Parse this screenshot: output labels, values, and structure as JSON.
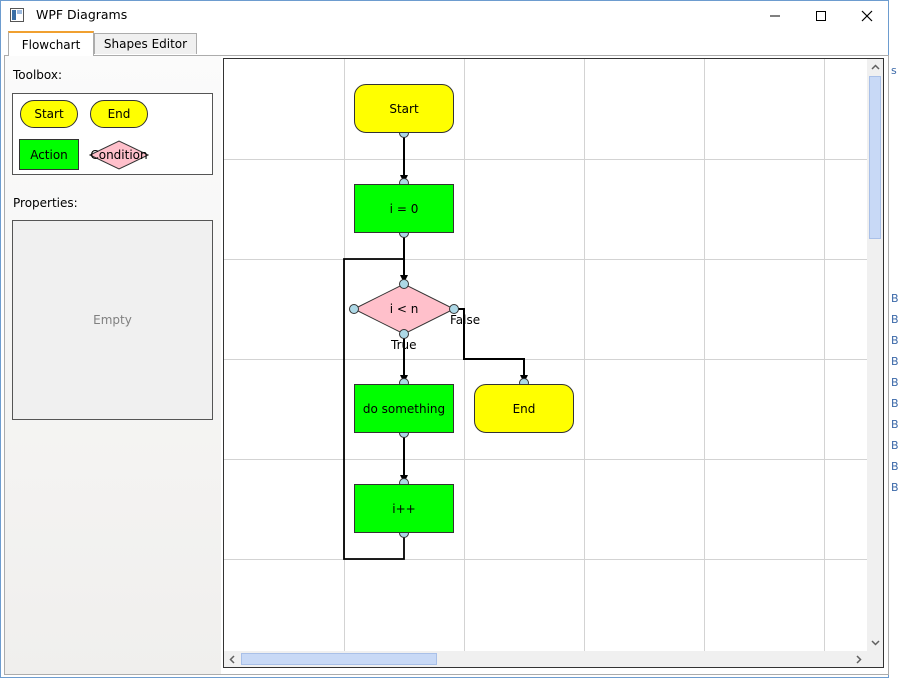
{
  "window": {
    "title": "WPF Diagrams"
  },
  "tabs": [
    {
      "label": "Flowchart"
    },
    {
      "label": "Shapes Editor"
    }
  ],
  "sidebar": {
    "toolbox_label": "Toolbox:",
    "toolbox_items": {
      "start": "Start",
      "end": "End",
      "action": "Action",
      "condition": "Condition"
    },
    "properties_label": "Properties:",
    "properties_empty": "Empty"
  },
  "diagram": {
    "start": "Start",
    "init": "i = 0",
    "condition": "i < n",
    "true_label": "True",
    "false_label": "False",
    "action": "do something",
    "increment": "i++",
    "end": "End"
  },
  "background_fragment": {
    "text_letter": "B",
    "top_letter": "s"
  },
  "colors": {
    "terminal": "#ffff00",
    "action": "#00ff00",
    "condition": "#ffc0cb",
    "connector": "#add8e6",
    "grid": "#d3d3d3",
    "tab_accent": "#f0a030",
    "scroll_thumb": "#c8d9f6"
  },
  "icons": [
    "app-icon",
    "minimize-icon",
    "maximize-icon",
    "close-icon",
    "scroll-up-icon",
    "scroll-down-icon",
    "scroll-left-icon",
    "scroll-right-icon"
  ]
}
